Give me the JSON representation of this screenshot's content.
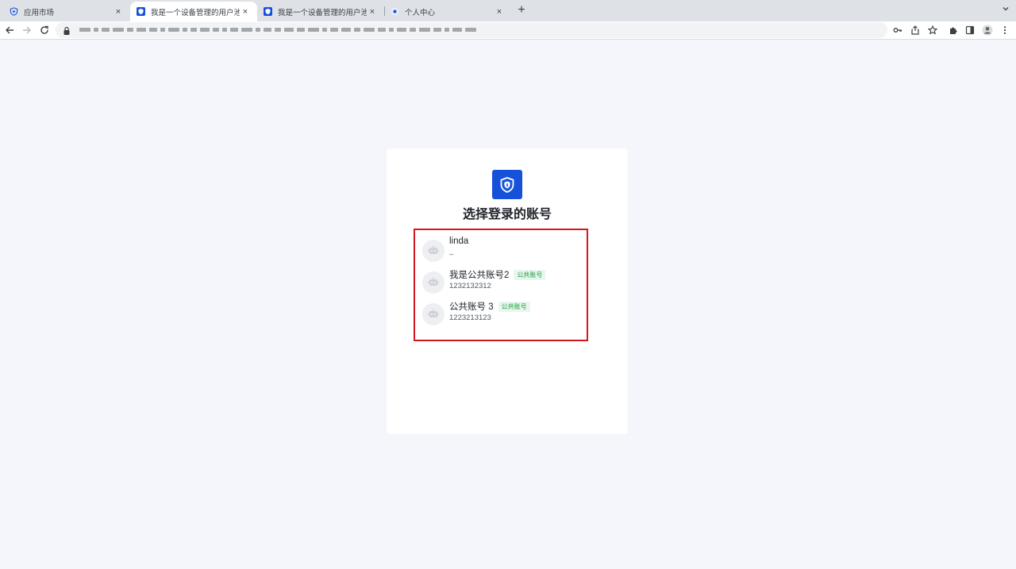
{
  "browser": {
    "tabs": [
      {
        "title": "应用市场",
        "active": false
      },
      {
        "title": "我是一个设备管理的用户池",
        "active": true
      },
      {
        "title": "我是一个设备管理的用户池",
        "active": false
      },
      {
        "title": "个人中心",
        "active": false
      }
    ],
    "close_glyph": "×",
    "new_tab_glyph": "+"
  },
  "page": {
    "heading": "选择登录的账号",
    "accounts": [
      {
        "name": "linda",
        "sub": "–",
        "badge": ""
      },
      {
        "name": "我是公共账号2",
        "sub": "1232132312",
        "badge": "公共账号"
      },
      {
        "name": "公共账号 3",
        "sub": "1223213123",
        "badge": "公共账号"
      }
    ]
  },
  "colors": {
    "brand": "#1652d9",
    "highlight": "#d3171e",
    "badge_text": "#1a9b3d",
    "badge_bg": "#e8f7ec",
    "page_bg": "#f5f6fc"
  },
  "icons": {
    "logo": "shield-icon",
    "avatar": "robot-avatar-icon"
  }
}
